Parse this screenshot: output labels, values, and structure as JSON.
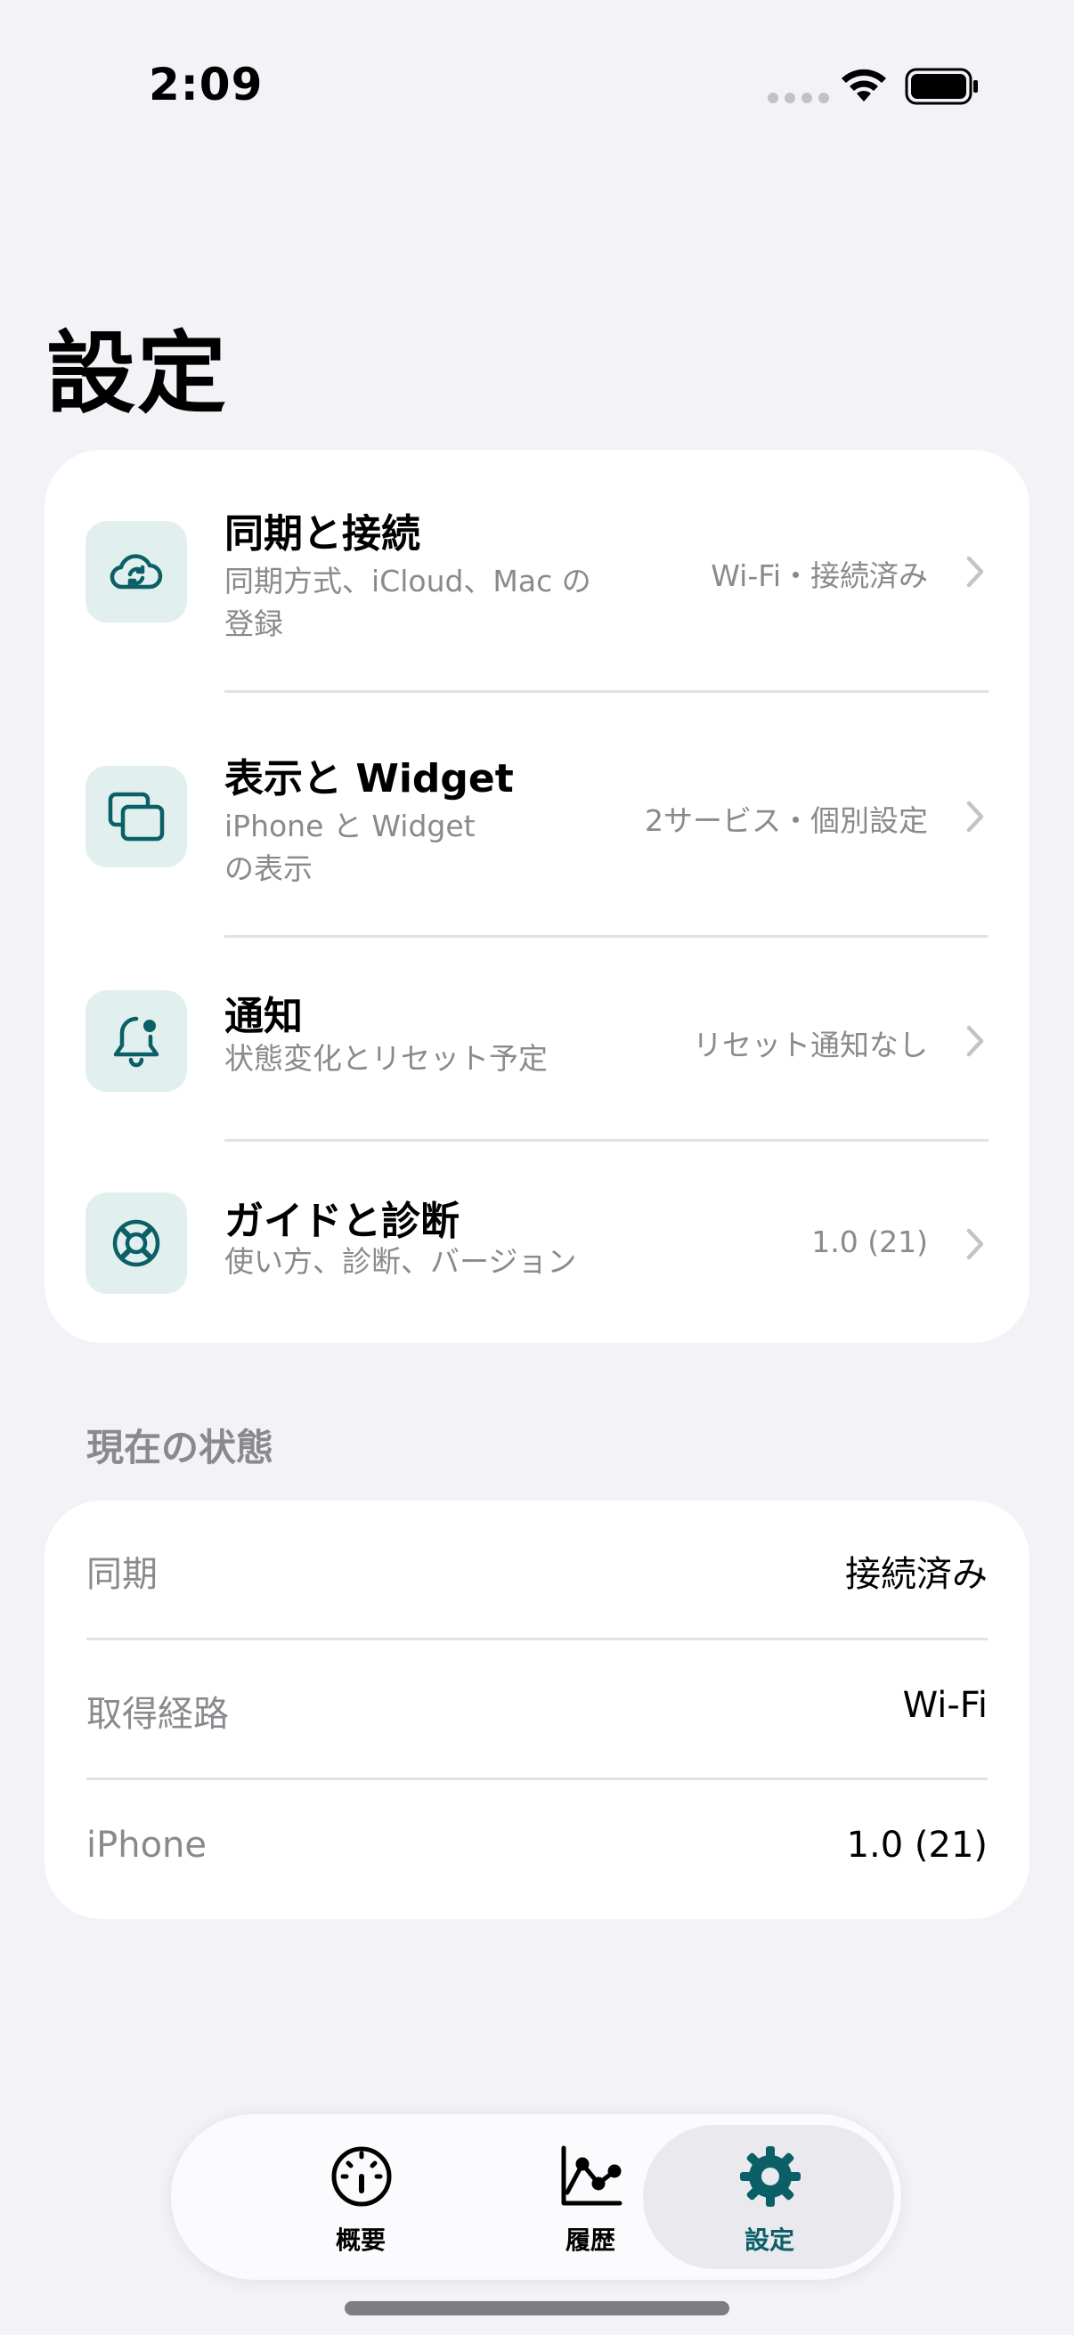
{
  "status_bar": {
    "time": "2:09"
  },
  "page": {
    "title": "設定"
  },
  "menu": [
    {
      "title": "同期と接続",
      "subtitle": "同期方式、iCloud、Mac の登録",
      "detail": "Wi-Fi・接続済み",
      "icon": "cloud-sync-icon"
    },
    {
      "title": "表示と Widget",
      "subtitle": "iPhone と Widget の表示",
      "detail": "2サービス・個別設定",
      "icon": "windows-icon"
    },
    {
      "title": "通知",
      "subtitle": "状態変化とリセット予定",
      "detail": "リセット通知なし",
      "icon": "bell-badge-icon"
    },
    {
      "title": "ガイドと診断",
      "subtitle": "使い方、診断、バージョン",
      "detail": "1.0 (21)",
      "icon": "lifebuoy-icon"
    }
  ],
  "status_section": {
    "header": "現在の状態",
    "rows": [
      {
        "label": "同期",
        "value": "接続済み"
      },
      {
        "label": "取得経路",
        "value": "Wi-Fi"
      },
      {
        "label": "iPhone",
        "value": "1.0 (21)"
      }
    ]
  },
  "tabs": [
    {
      "label": "概要",
      "icon": "gauge-icon",
      "active": false
    },
    {
      "label": "履歴",
      "icon": "chart-line-icon",
      "active": false
    },
    {
      "label": "設定",
      "icon": "gear-icon",
      "active": true
    }
  ],
  "colors": {
    "accent": "#0b5f66",
    "icon_bg": "#e1efee",
    "background": "#f2f2f7"
  }
}
